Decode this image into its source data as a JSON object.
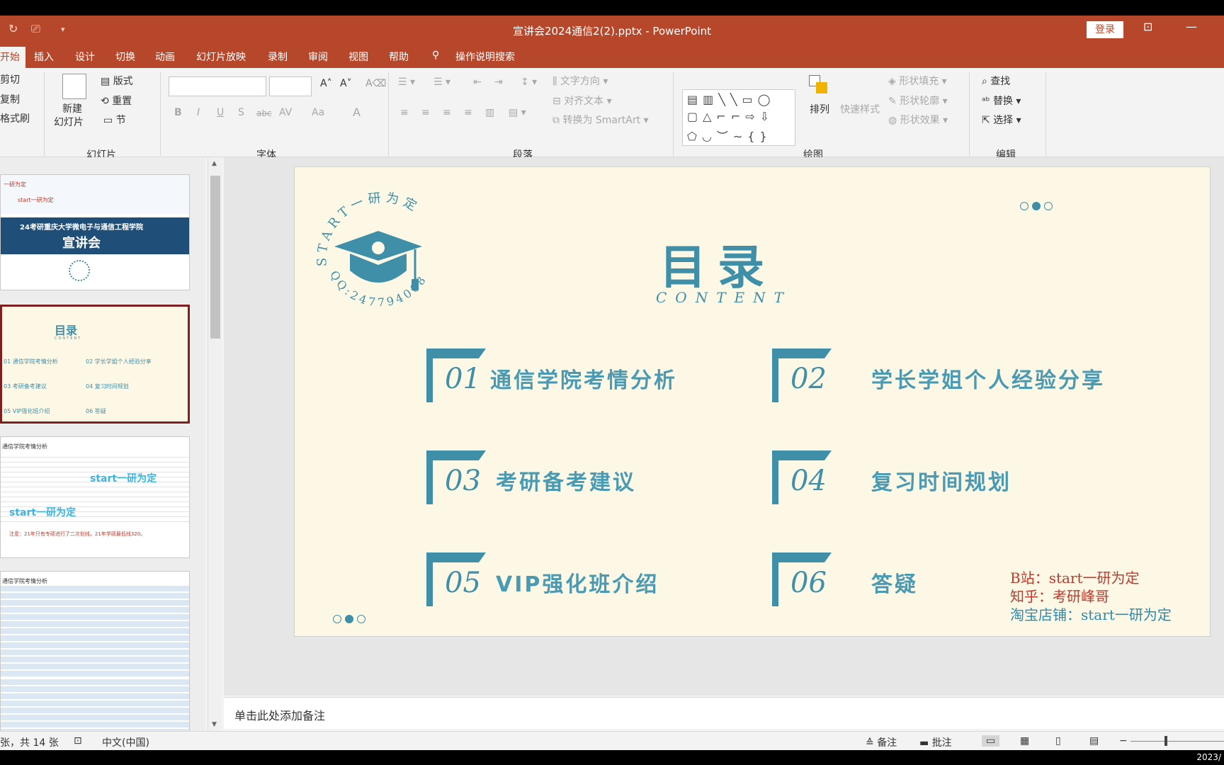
{
  "window": {
    "title": "宣讲会2024通信2(2).pptx  -  PowerPoint",
    "login": "登录"
  },
  "tabs": [
    "开始",
    "插入",
    "设计",
    "切换",
    "动画",
    "幻灯片放映",
    "录制",
    "审阅",
    "视图",
    "帮助"
  ],
  "tell_me": "操作说明搜索",
  "ribbon": {
    "clipboard": {
      "cut": "剪切",
      "copy": "复制",
      "format_painter": "格式刷"
    },
    "slides": {
      "new_slide_l1": "新建",
      "new_slide_l2": "幻灯片",
      "layout": "版式",
      "reset": "重置",
      "section": "节",
      "group": "幻灯片"
    },
    "font": {
      "group": "字体",
      "bold": "B",
      "italic": "I",
      "underline": "U",
      "shadow": "S",
      "strike": "abc",
      "spacing": "AV",
      "case": "Aa",
      "color": "A"
    },
    "paragraph": {
      "group": "段落",
      "text_direction": "文字方向",
      "align_text": "对齐文本",
      "smartart": "转换为 SmartArt"
    },
    "drawing": {
      "group": "绘图",
      "arrange": "排列",
      "quick_styles": "快速样式",
      "shape_fill": "形状填充",
      "shape_outline": "形状轮廓",
      "shape_effects": "形状效果"
    },
    "editing": {
      "group": "编辑",
      "find": "查找",
      "replace": "替换",
      "select": "选择"
    }
  },
  "thumbnails": {
    "t1": {
      "header": "24考研重庆大学微电子与通信工程学院",
      "title": "宣讲会",
      "tag1": "一研为定",
      "tag2": "start一研为定"
    },
    "t2": {
      "title": "目录",
      "sub": "CONTENT",
      "items": [
        "01 通信学院考情分析",
        "02 学长学姐个人经验分享",
        "03 考研备考建议",
        "04 复习时间规划",
        "05 VIP强化班介绍",
        "06 答疑"
      ]
    },
    "t3": {
      "title": "通信学院考情分析",
      "wm1": "start一研为定",
      "wm2": "start一研为定",
      "note": "注意：21年只有专硕进行了二次划线，21年学硕最低线320。"
    },
    "t4": {
      "title": "通信学院考情分析"
    }
  },
  "slide": {
    "logo_ring": "START一研为定",
    "logo_qq": "QQ:2477940089",
    "title": "目录",
    "subtitle": "CONTENT",
    "items": [
      {
        "num": "01",
        "label": "通信学院考情分析"
      },
      {
        "num": "02",
        "label": "学长学姐个人经验分享"
      },
      {
        "num": "03",
        "label": "考研备考建议"
      },
      {
        "num": "04",
        "label": "复习时间规划"
      },
      {
        "num": "05",
        "label": "VIP强化班介绍"
      },
      {
        "num": "06",
        "label": "答疑"
      }
    ],
    "credits": {
      "bili": "B站：start一研为定",
      "zhihu": "知乎：考研峰哥",
      "taobao": "淘宝店铺：start一研为定"
    },
    "colors": {
      "accent": "#3f8fa8",
      "credit_red": "#c0392b",
      "credit_blue": "#2a8ab0",
      "bg": "#fdf8e6"
    }
  },
  "notes": "单击此处添加备注",
  "status": {
    "slide_count": "张，共 14 张",
    "language": "中文(中国)",
    "notes_btn": "备注",
    "comments_btn": "批注"
  },
  "taskbar": {
    "time": "2023/"
  }
}
